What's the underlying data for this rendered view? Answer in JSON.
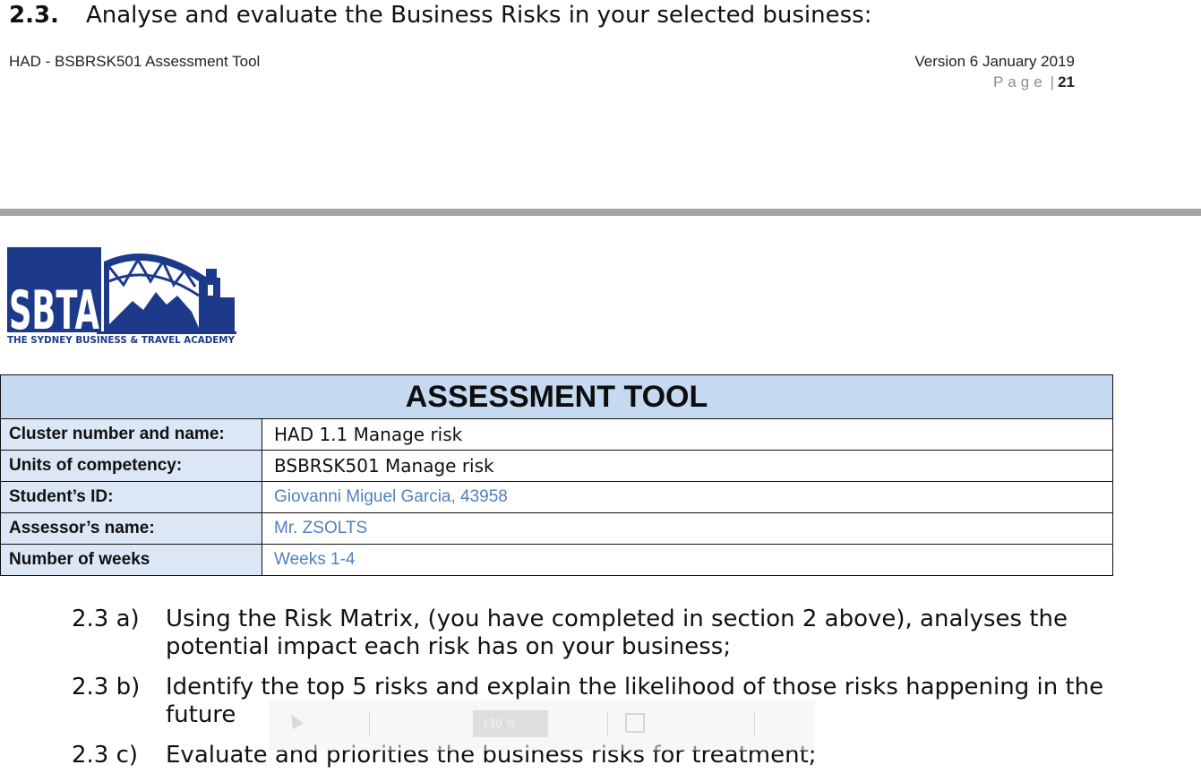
{
  "prev_page": {
    "section_number": "2.3.",
    "section_heading": "Analyse and evaluate the Business Risks in your selected business:",
    "footer_left": "HAD - BSBRSK501 Assessment Tool",
    "footer_version": "Version 6 January 2019",
    "page_word": "Page",
    "page_separator": "|",
    "page_number": "21"
  },
  "logo": {
    "letters": "SBTA",
    "tagline": "THE SYDNEY BUSINESS & TRAVEL ACADEMY",
    "colors": {
      "navy": "#1d3a8a"
    }
  },
  "assessment_table": {
    "title": "ASSESSMENT TOOL",
    "rows": [
      {
        "label": "Cluster number and name:",
        "value": "HAD 1.1  Manage risk"
      },
      {
        "label": "Units of competency:",
        "value": "BSBRSK501 Manage risk"
      },
      {
        "label": "Student’s ID:",
        "value": "Giovanni Miguel Garcia, 43958"
      },
      {
        "label": "Assessor’s name:",
        "value": "Mr. ZSOLTS"
      },
      {
        "label": "Number of weeks",
        "value": "Weeks 1-4"
      }
    ],
    "colors": {
      "title_bg": "#c5d9f0",
      "label_bg": "#dbe7f5",
      "filled_text": "#4f81bd"
    }
  },
  "tasks": [
    {
      "number": "2.3 a)",
      "text": "Using the Risk Matrix, (you have completed in section 2 above), analyses the potential impact each risk has on your business;"
    },
    {
      "number": "2.3 b)",
      "text": "Identify the top 5 risks and explain the likelihood of those risks happening in the future"
    },
    {
      "number": "2.3 c)",
      "text": "Evaluate and priorities the business risks for treatment;"
    }
  ],
  "viewer_toolbar": {
    "zoom_value": "130 %",
    "icons": [
      "cursor-icon",
      "save-icon"
    ]
  }
}
